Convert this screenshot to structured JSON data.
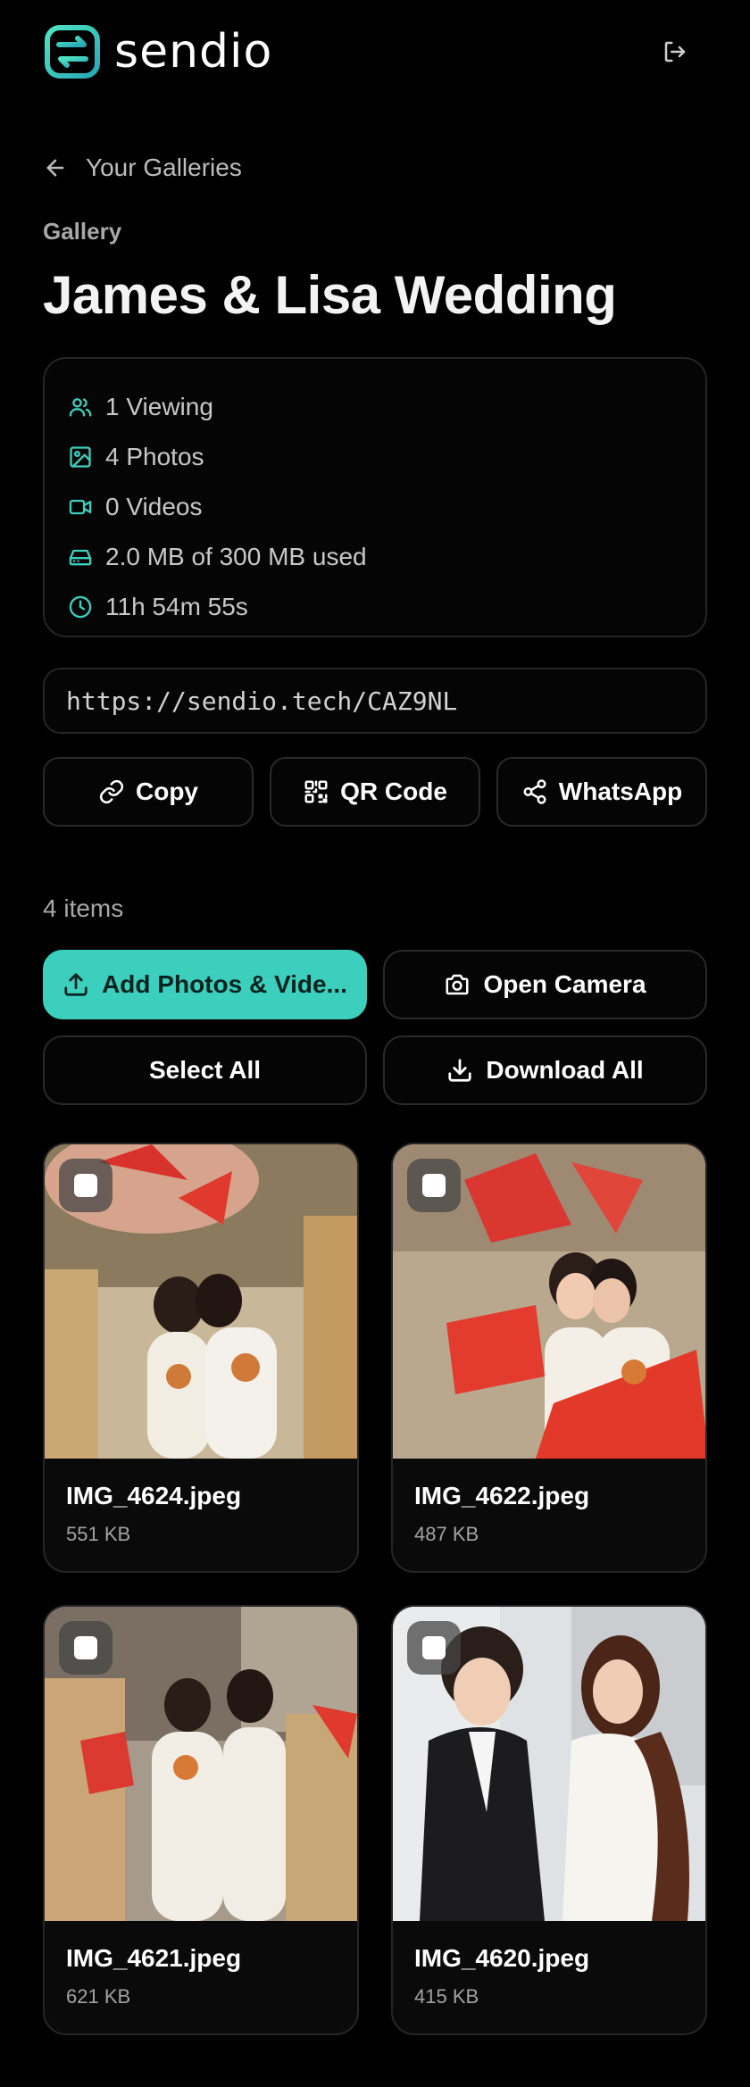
{
  "app": {
    "name": "sendio"
  },
  "nav": {
    "back_label": "Your Galleries"
  },
  "gallery": {
    "eyebrow": "Gallery",
    "title": "James & Lisa Wedding"
  },
  "stats": [
    {
      "icon": "users-icon",
      "text": "1 Viewing"
    },
    {
      "icon": "image-icon",
      "text": "4 Photos"
    },
    {
      "icon": "video-icon",
      "text": "0 Videos"
    },
    {
      "icon": "storage-icon",
      "text": "2.0 MB of 300 MB used"
    },
    {
      "icon": "clock-icon",
      "text": "11h 54m 55s"
    }
  ],
  "share": {
    "url": "https://sendio.tech/CAZ9NL",
    "copy_label": "Copy",
    "qr_label": "QR Code",
    "whatsapp_label": "WhatsApp"
  },
  "items": {
    "count_label": "4 items",
    "add_label": "Add Photos & Vide...",
    "camera_label": "Open Camera",
    "select_all_label": "Select All",
    "download_all_label": "Download All"
  },
  "photos": [
    {
      "name": "IMG_4624.jpeg",
      "size": "551 KB"
    },
    {
      "name": "IMG_4622.jpeg",
      "size": "487 KB"
    },
    {
      "name": "IMG_4621.jpeg",
      "size": "621 KB"
    },
    {
      "name": "IMG_4620.jpeg",
      "size": "415 KB"
    }
  ],
  "colors": {
    "accent": "#3ccfbd",
    "background": "#000000",
    "card_border": "#262626"
  }
}
